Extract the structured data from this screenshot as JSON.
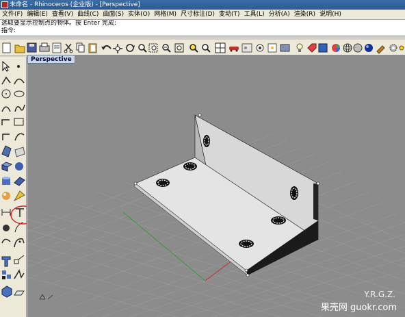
{
  "window": {
    "title": "未命名 - Rhinoceros (企业版) - [Perspective]"
  },
  "menu": [
    "文件(F)",
    "编辑(E)",
    "查看(V)",
    "曲线(C)",
    "曲面(S)",
    "实体(O)",
    "网格(M)",
    "尺寸标注(D)",
    "变动(T)",
    "工具(L)",
    "分析(A)",
    "渲染(R)",
    "说明(H)"
  ],
  "command": {
    "line1": "选取要显示控制点的物体。按 Enter 完成:",
    "line2": "指令:"
  },
  "viewport": {
    "label": "Perspective"
  },
  "watermark": {
    "line1": "Y.R.G.Z.",
    "line2": "果壳网 guokr.com"
  },
  "colors": {
    "highlight_circle": "#e02020",
    "x_axis": "#c83030",
    "y_axis": "#30a030"
  }
}
